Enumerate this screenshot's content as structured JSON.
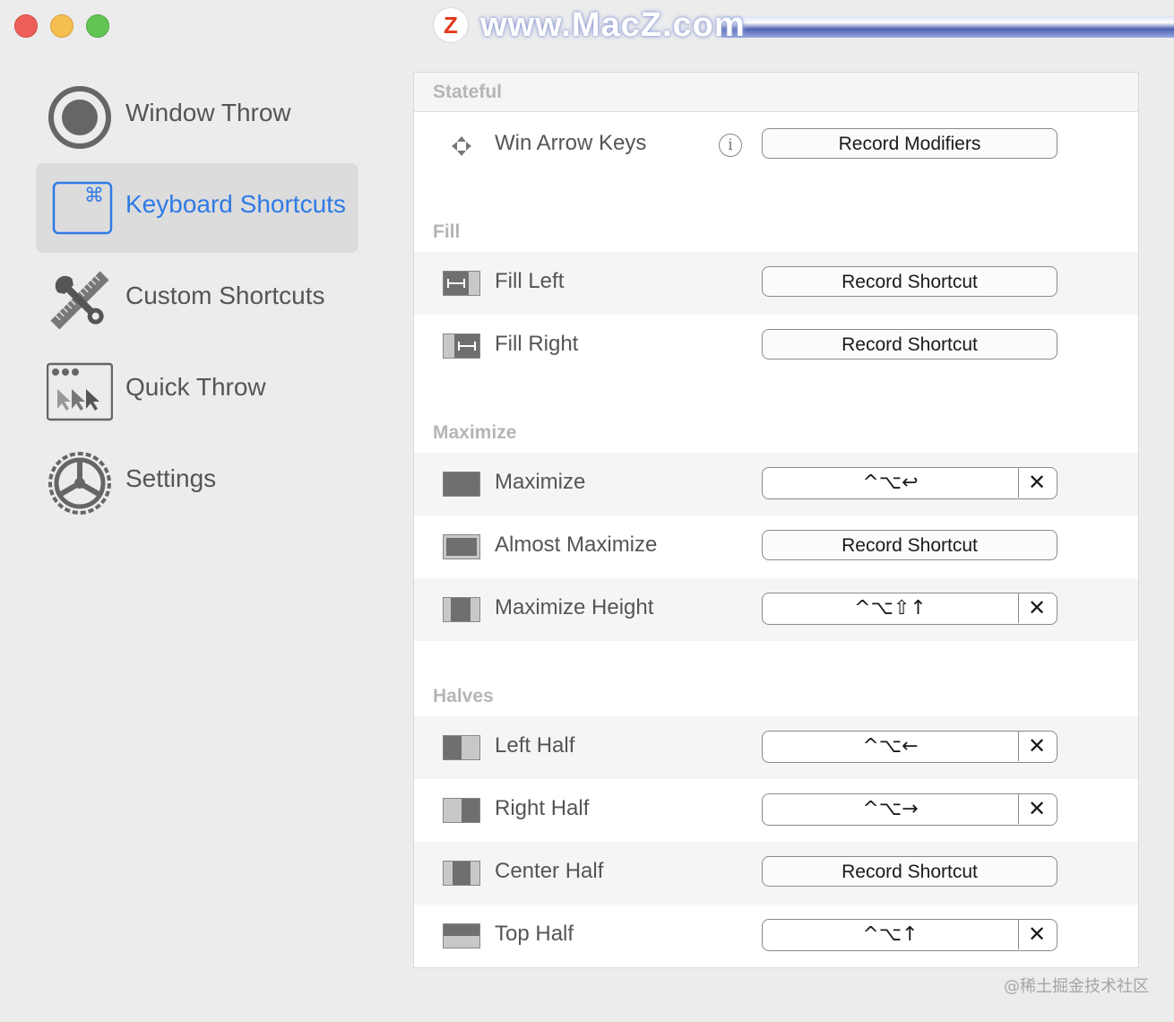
{
  "titlebar": {
    "watermark_logo": "Z",
    "watermark_text": "www.MacZ.com"
  },
  "sidebar": {
    "items": [
      {
        "label": "Window Throw",
        "icon": "window-throw-icon"
      },
      {
        "label": "Keyboard Shortcuts",
        "icon": "keyboard-shortcuts-icon",
        "active": true,
        "icon_glyph": "⌘"
      },
      {
        "label": "Custom Shortcuts",
        "icon": "custom-shortcuts-icon"
      },
      {
        "label": "Quick Throw",
        "icon": "quick-throw-icon"
      },
      {
        "label": "Settings",
        "icon": "settings-icon"
      }
    ]
  },
  "sections": {
    "stateful": {
      "title": "Stateful",
      "rows": [
        {
          "label": "Win Arrow Keys",
          "button": "Record Modifiers",
          "info": "i"
        }
      ]
    },
    "fill": {
      "title": "Fill",
      "rows": [
        {
          "label": "Fill Left",
          "button": "Record Shortcut"
        },
        {
          "label": "Fill Right",
          "button": "Record Shortcut"
        }
      ]
    },
    "maximize": {
      "title": "Maximize",
      "rows": [
        {
          "label": "Maximize",
          "shortcut": "^⌥↩",
          "clear": "✕"
        },
        {
          "label": "Almost Maximize",
          "button": "Record Shortcut"
        },
        {
          "label": "Maximize Height",
          "shortcut": "^⌥⇧↑",
          "clear": "✕"
        }
      ]
    },
    "halves": {
      "title": "Halves",
      "rows": [
        {
          "label": "Left Half",
          "shortcut": "^⌥←",
          "clear": "✕"
        },
        {
          "label": "Right Half",
          "shortcut": "^⌥→",
          "clear": "✕"
        },
        {
          "label": "Center Half",
          "button": "Record Shortcut"
        },
        {
          "label": "Top Half",
          "shortcut": "^⌥↑",
          "clear": "✕"
        }
      ]
    }
  },
  "footer": {
    "watermark": "@稀土掘金技术社区"
  },
  "colors": {
    "accent": "#2f7ae5",
    "sidebar_active_bg": "#dcdcdc",
    "window_bg": "#ececec"
  }
}
